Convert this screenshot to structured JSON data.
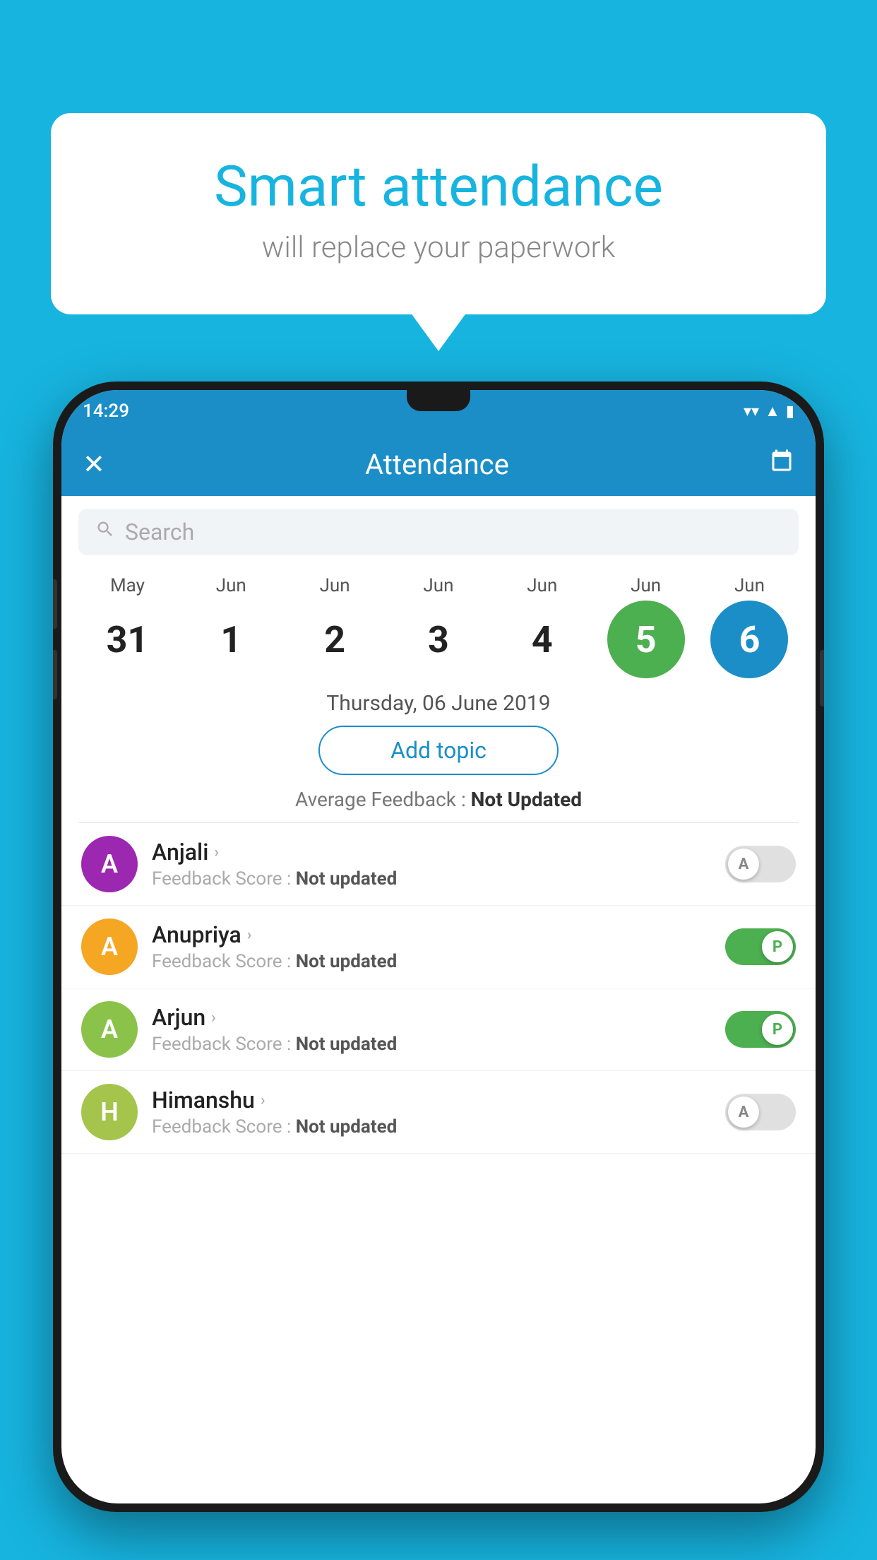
{
  "background_color": "#17b4e0",
  "speech_bubble": {
    "title": "Smart attendance",
    "subtitle": "will replace your paperwork"
  },
  "status_bar": {
    "time": "14:29",
    "wifi_icon": "▼",
    "signal_icon": "▲",
    "battery_icon": "▮"
  },
  "app_header": {
    "close_label": "✕",
    "title": "Attendance",
    "calendar_icon": "📅"
  },
  "search": {
    "placeholder": "Search"
  },
  "dates": [
    {
      "month": "May",
      "day": "31",
      "state": "normal"
    },
    {
      "month": "Jun",
      "day": "1",
      "state": "normal"
    },
    {
      "month": "Jun",
      "day": "2",
      "state": "normal"
    },
    {
      "month": "Jun",
      "day": "3",
      "state": "normal"
    },
    {
      "month": "Jun",
      "day": "4",
      "state": "normal"
    },
    {
      "month": "Jun",
      "day": "5",
      "state": "today"
    },
    {
      "month": "Jun",
      "day": "6",
      "state": "selected"
    }
  ],
  "selected_date_label": "Thursday, 06 June 2019",
  "add_topic_label": "Add topic",
  "avg_feedback_label": "Average Feedback : ",
  "avg_feedback_value": "Not Updated",
  "students": [
    {
      "name": "Anjali",
      "avatar_letter": "A",
      "avatar_color": "#9c27b0",
      "feedback_label": "Feedback Score : ",
      "feedback_value": "Not updated",
      "toggle_state": "off",
      "toggle_letter": "A"
    },
    {
      "name": "Anupriya",
      "avatar_letter": "A",
      "avatar_color": "#f5a623",
      "feedback_label": "Feedback Score : ",
      "feedback_value": "Not updated",
      "toggle_state": "on",
      "toggle_letter": "P"
    },
    {
      "name": "Arjun",
      "avatar_letter": "A",
      "avatar_color": "#8bc34a",
      "feedback_label": "Feedback Score : ",
      "feedback_value": "Not updated",
      "toggle_state": "on",
      "toggle_letter": "P"
    },
    {
      "name": "Himanshu",
      "avatar_letter": "H",
      "avatar_color": "#a5c44b",
      "feedback_label": "Feedback Score : ",
      "feedback_value": "Not updated",
      "toggle_state": "off",
      "toggle_letter": "A"
    }
  ]
}
